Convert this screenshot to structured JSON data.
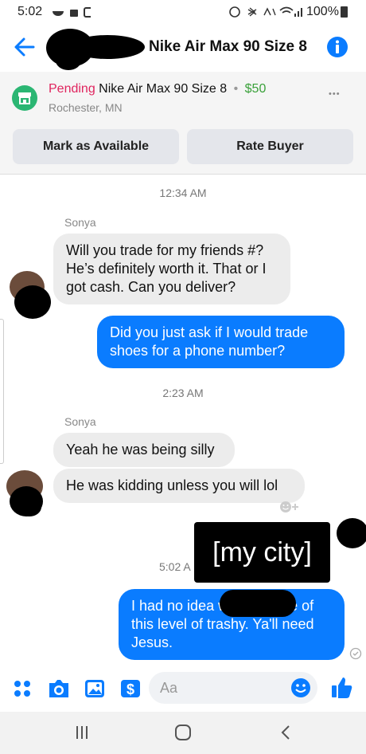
{
  "status": {
    "time": "5:02",
    "battery": "100%"
  },
  "header": {
    "title": "Nike Air Max 90 Size 8"
  },
  "listing": {
    "status": "Pending",
    "title": "Nike Air Max 90 Size 8",
    "separator": "•",
    "price": "$50",
    "location": "Rochester, MN",
    "more": "•••",
    "mark_available": "Mark as Available",
    "rate_buyer": "Rate Buyer"
  },
  "chat": {
    "ts1": "12:34 AM",
    "sender1": "Sonya",
    "msg1": "Will you trade for my friends #? He’s definitely worth it. That or I got cash. Can you deliver?",
    "msg2": "Did you just ask if I would trade shoes for a phone number?",
    "ts2": "2:23 AM",
    "sender2": "Sonya",
    "msg3": "Yeah he was being silly",
    "msg4": "He was kidding unless you will lol",
    "ts3": "5:02 A",
    "overlay": "[my city]",
    "msg5": "I had no idea                    was capable of this level of trashy. Ya'll need Jesus."
  },
  "composer": {
    "placeholder": "Aa"
  },
  "colors": {
    "accent": "#0a7cff",
    "pending": "#e0245e",
    "price": "#3aa13a"
  }
}
